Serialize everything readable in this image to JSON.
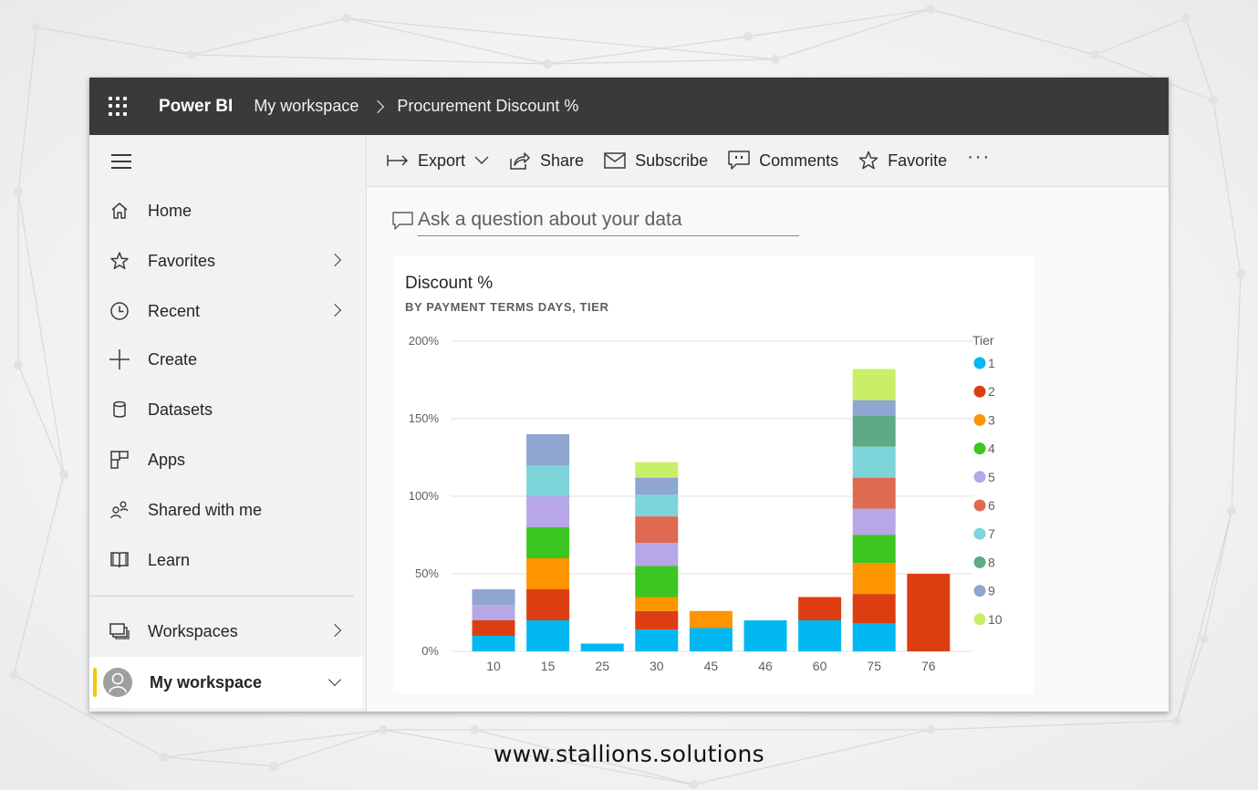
{
  "topbar": {
    "brand": "Power BI",
    "breadcrumb": [
      "My workspace",
      "Procurement Discount %"
    ]
  },
  "sidebar": {
    "items": [
      {
        "label": "Home",
        "icon": "home-icon",
        "chevron": false
      },
      {
        "label": "Favorites",
        "icon": "star-icon",
        "chevron": true
      },
      {
        "label": "Recent",
        "icon": "clock-icon",
        "chevron": true
      },
      {
        "label": "Create",
        "icon": "plus-icon",
        "chevron": false
      },
      {
        "label": "Datasets",
        "icon": "database-icon",
        "chevron": false
      },
      {
        "label": "Apps",
        "icon": "apps-icon",
        "chevron": false
      },
      {
        "label": "Shared with me",
        "icon": "people-icon",
        "chevron": false
      },
      {
        "label": "Learn",
        "icon": "book-icon",
        "chevron": false
      }
    ],
    "workspaces_label": "Workspaces",
    "my_workspace_label": "My workspace",
    "accent_color": "#f2c80f"
  },
  "actions": {
    "export": "Export",
    "share": "Share",
    "subscribe": "Subscribe",
    "comments": "Comments",
    "favorite": "Favorite",
    "more": "···"
  },
  "qa": {
    "placeholder": "Ask a question about your data"
  },
  "card": {
    "title": "Discount %",
    "subtitle": "BY PAYMENT TERMS DAYS, TIER"
  },
  "chart_data": {
    "type": "bar",
    "stacked": true,
    "title": "Discount %",
    "subtitle": "BY PAYMENT TERMS DAYS, TIER",
    "xlabel": "",
    "ylabel": "",
    "ylim": [
      0,
      200
    ],
    "yticks": [
      0,
      50,
      100,
      150,
      200
    ],
    "ytick_labels": [
      "0%",
      "50%",
      "100%",
      "150%",
      "200%"
    ],
    "grid": true,
    "legend_title": "Tier",
    "legend_position": "right",
    "categories": [
      "10",
      "15",
      "25",
      "30",
      "45",
      "46",
      "60",
      "75",
      "76"
    ],
    "series": [
      {
        "name": "1",
        "color": "#01b8f1",
        "values": [
          10,
          20,
          5,
          14,
          15,
          20,
          20,
          18,
          0
        ]
      },
      {
        "name": "2",
        "color": "#dd3e11",
        "values": [
          10,
          20,
          0,
          12,
          0,
          0,
          15,
          19,
          50
        ]
      },
      {
        "name": "3",
        "color": "#fd9500",
        "values": [
          0,
          20,
          0,
          9,
          11,
          0,
          0,
          20,
          0
        ]
      },
      {
        "name": "4",
        "color": "#3bc621",
        "values": [
          0,
          20,
          0,
          20,
          0,
          0,
          0,
          18,
          0
        ]
      },
      {
        "name": "5",
        "color": "#b7a7e7",
        "values": [
          10,
          20,
          0,
          15,
          0,
          0,
          0,
          17,
          0
        ]
      },
      {
        "name": "6",
        "color": "#de6a51",
        "values": [
          0,
          0,
          0,
          17,
          0,
          0,
          0,
          20,
          0
        ]
      },
      {
        "name": "7",
        "color": "#7dd4d9",
        "values": [
          0,
          20,
          0,
          14,
          0,
          0,
          0,
          20,
          0
        ]
      },
      {
        "name": "8",
        "color": "#5faa86",
        "values": [
          0,
          0,
          0,
          0,
          0,
          0,
          0,
          20,
          0
        ]
      },
      {
        "name": "9",
        "color": "#8ea6d0",
        "values": [
          10,
          20,
          0,
          11,
          0,
          0,
          0,
          10,
          0
        ]
      },
      {
        "name": "10",
        "color": "#c9ee67",
        "values": [
          0,
          0,
          0,
          10,
          0,
          0,
          0,
          20,
          0
        ]
      }
    ]
  },
  "footer": {
    "text": "www.stallions.solutions"
  }
}
